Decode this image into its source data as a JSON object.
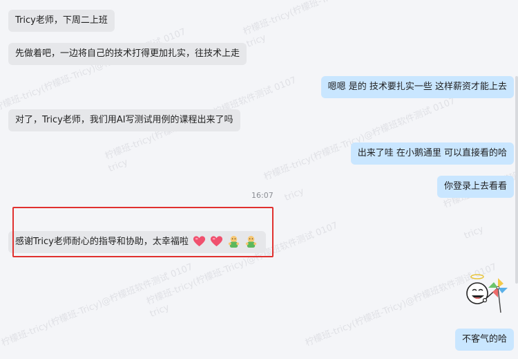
{
  "watermark": {
    "text": "柠檬班-tricy(柠檬班-Tricy)@柠檬班软件测试 0107",
    "short": "tricy"
  },
  "messages": [
    {
      "side": "in",
      "text": "Tricy老师，下周二上班"
    },
    {
      "side": "in",
      "text": "先做着吧，一边将自己的技术打得更加扎实，往技术上走"
    },
    {
      "side": "out",
      "text": "嗯嗯 是的  技术要扎实一些 这样薪资才能上去"
    },
    {
      "side": "in",
      "text": "对了，Tricy老师，我们用AI写测试用例的课程出来了吗"
    },
    {
      "side": "out",
      "text": "出来了哇  在小鹅通里 可以直接看的哈"
    },
    {
      "side": "out",
      "text": "你登录上去看看"
    },
    {
      "side": "in",
      "text": "感谢Tricy老师耐心的指导和协助，太幸福啦"
    },
    {
      "side": "out",
      "text": "不客气的哈"
    }
  ],
  "timestamp": "16:07",
  "emojis": [
    "heart-icon",
    "heart-icon",
    "thumbs-up-hands-icon",
    "thumbs-up-hands-icon"
  ],
  "sticker": "pinwheel-smiley-sticker",
  "colors": {
    "incoming_bubble": "#e6e7ea",
    "outgoing_bubble": "#c9e6ff",
    "highlight": "#e0302e",
    "background": "#f4f5f8"
  }
}
